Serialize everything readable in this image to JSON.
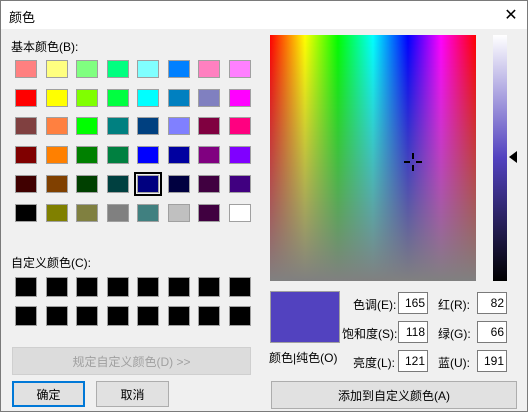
{
  "window": {
    "title": "颜色"
  },
  "basic_colors": {
    "label": "基本颜色(B):",
    "selected_index": 36,
    "swatches": [
      "#ff8080",
      "#ffff80",
      "#80ff80",
      "#00ff80",
      "#80ffff",
      "#0080ff",
      "#ff80c0",
      "#ff80ff",
      "#ff0000",
      "#ffff00",
      "#80ff00",
      "#00ff40",
      "#00ffff",
      "#0080c0",
      "#8080c0",
      "#ff00ff",
      "#804040",
      "#ff8040",
      "#00ff00",
      "#008080",
      "#004080",
      "#8080ff",
      "#800040",
      "#ff0080",
      "#800000",
      "#ff8000",
      "#008000",
      "#008040",
      "#0000ff",
      "#0000a0",
      "#800080",
      "#8000ff",
      "#400000",
      "#804000",
      "#004000",
      "#004040",
      "#000080",
      "#000040",
      "#400040",
      "#400080",
      "#000000",
      "#808000",
      "#808040",
      "#808080",
      "#408080",
      "#c0c0c0",
      "#400040",
      "#ffffff"
    ]
  },
  "custom_colors": {
    "label": "自定义颜色(C):",
    "swatches": [
      "#000000",
      "#000000",
      "#000000",
      "#000000",
      "#000000",
      "#000000",
      "#000000",
      "#000000",
      "#000000",
      "#000000",
      "#000000",
      "#000000",
      "#000000",
      "#000000",
      "#000000",
      "#000000"
    ]
  },
  "buttons": {
    "define_custom": "规定自定义颜色(D) >>",
    "ok": "确定",
    "cancel": "取消",
    "add_custom": "添加到自定义颜色(A)"
  },
  "preview": {
    "label": "颜色|纯色(O)",
    "color": "#5242bf"
  },
  "hsl": {
    "hue_label": "色调(E):",
    "hue": "165",
    "sat_label": "饱和度(S):",
    "sat": "118",
    "lum_label": "亮度(L):",
    "lum": "121"
  },
  "rgb": {
    "red_label": "红(R):",
    "red": "82",
    "green_label": "绿(G):",
    "green": "66",
    "blue_label": "蓝(U):",
    "blue": "191"
  }
}
